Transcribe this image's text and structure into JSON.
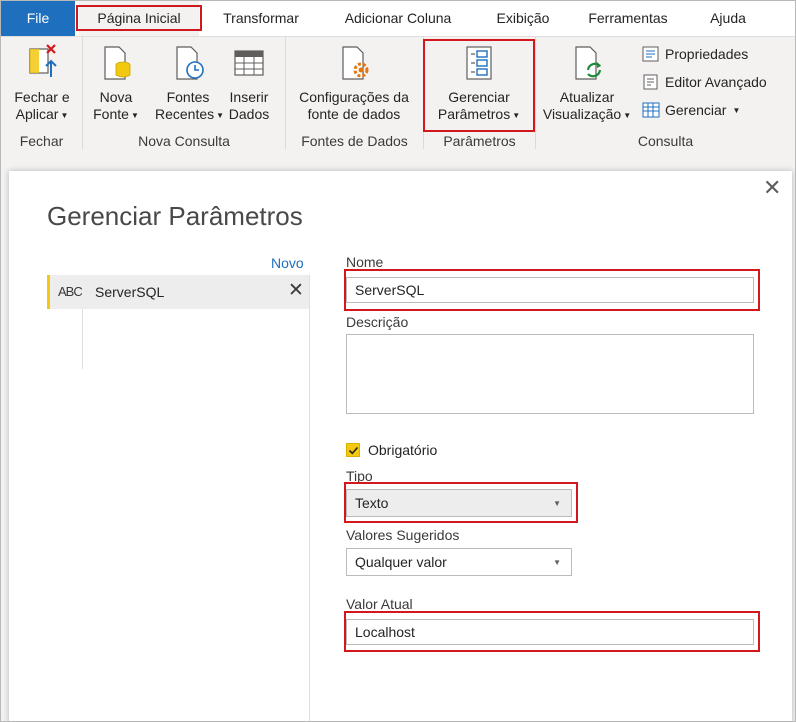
{
  "tabs": {
    "file": "File",
    "home": "Página Inicial",
    "transform": "Transformar",
    "add_column": "Adicionar Coluna",
    "view": "Exibição",
    "tools": "Ferramentas",
    "help": "Ajuda"
  },
  "ribbon": {
    "close_apply": [
      "Fechar e",
      "Aplicar"
    ],
    "new_source": [
      "Nova",
      "Fonte"
    ],
    "recent_sources": [
      "Fontes",
      "Recentes"
    ],
    "enter_data": [
      "Inserir",
      "Dados"
    ],
    "data_source_settings": [
      "Configurações da",
      "fonte de dados"
    ],
    "manage_parameters": [
      "Gerenciar",
      "Parâmetros"
    ],
    "refresh_preview": [
      "Atualizar",
      "Visualização"
    ],
    "properties": "Propriedades",
    "advanced_editor": "Editor Avançado",
    "manage": "Gerenciar",
    "groups": {
      "close": "Fechar",
      "new_query": "Nova Consulta",
      "data_sources": "Fontes de Dados",
      "parameters": "Parâmetros",
      "query": "Consulta"
    }
  },
  "dialog": {
    "title": "Gerenciar Parâmetros",
    "new_link": "Novo",
    "close_glyph": "✕",
    "parameter": {
      "type_glyph": "ABC",
      "name": "ServerSQL",
      "delete_glyph": "✕"
    },
    "fields": {
      "name_label": "Nome",
      "name_value": "ServerSQL",
      "description_label": "Descrição",
      "description_value": "",
      "required_label": "Obrigatório",
      "required_checked": true,
      "type_label": "Tipo",
      "type_value": "Texto",
      "suggested_label": "Valores Sugeridos",
      "suggested_value": "Qualquer valor",
      "current_label": "Valor Atual",
      "current_value": "Localhost"
    }
  },
  "colors": {
    "file_tab": "#1f6fbf",
    "highlight": "#d3181d",
    "accent_yellow": "#f2c811",
    "link_blue": "#1f6fbf"
  }
}
